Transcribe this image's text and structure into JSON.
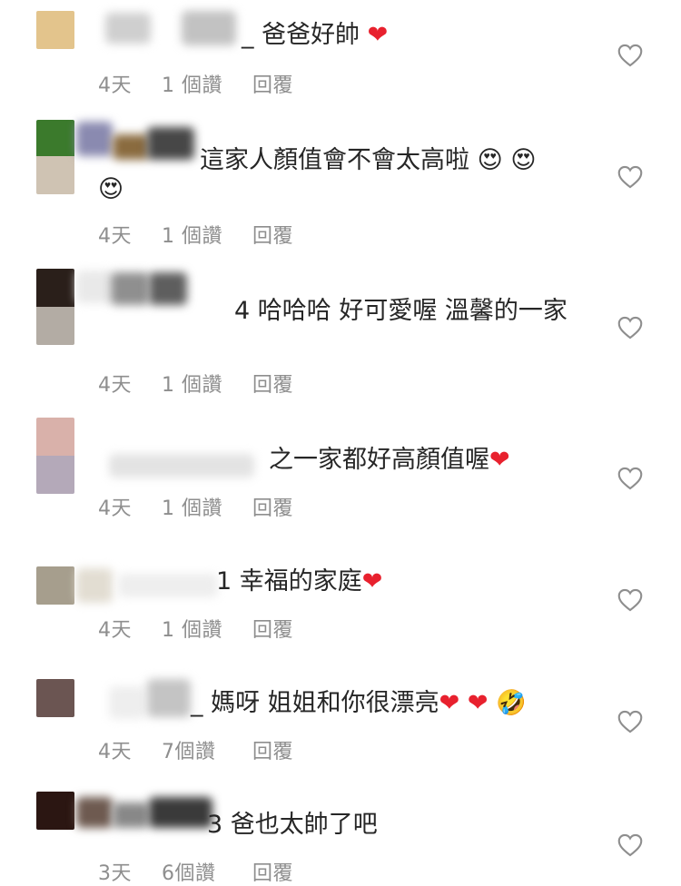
{
  "comments": [
    {
      "text": "_ 爸爸好帥",
      "emoji": [
        "heart"
      ],
      "time": "4天",
      "likes": "1 個讚",
      "reply": "回覆",
      "avatar_colors": [
        "#e3c48c"
      ]
    },
    {
      "text": "這家人顏值會不會太高啦",
      "emoji": [
        "heart-eyes",
        "heart-eyes",
        "heart-eyes"
      ],
      "time": "4天",
      "likes": "1 個讚",
      "reply": "回覆",
      "avatar_colors": [
        "#3b7a2c",
        "#cfc3b3"
      ]
    },
    {
      "text": "4 哈哈哈 好可愛喔 溫馨的一家",
      "emoji": [],
      "time": "4天",
      "likes": "1 個讚",
      "reply": "回覆",
      "avatar_colors": [
        "#2a1f1a",
        "#b3aca4"
      ]
    },
    {
      "text": "之一家都好高顏值喔",
      "emoji": [
        "heart"
      ],
      "time": "4天",
      "likes": "1 個讚",
      "reply": "回覆",
      "avatar_colors": [
        "#d9b1aa",
        "#b4a9b9"
      ]
    },
    {
      "text": "1 幸福的家庭",
      "emoji": [
        "heart"
      ],
      "time": "4天",
      "likes": "1 個讚",
      "reply": "回覆",
      "avatar_colors": [
        "#a69e8d"
      ]
    },
    {
      "text": "_ 媽呀 姐姐和你很漂亮",
      "emoji": [
        "heart",
        "heart",
        "rofl"
      ],
      "time": "4天",
      "likes": "7個讚",
      "reply": "回覆",
      "avatar_colors": [
        "#6b5552"
      ]
    },
    {
      "text": "3 爸也太帥了吧",
      "emoji": [],
      "time": "3天",
      "likes": "6個讚",
      "reply": "回覆",
      "avatar_colors": [
        "#2b1612"
      ]
    }
  ],
  "colors": {
    "text": "#262626",
    "meta": "#8e8e8e",
    "heart": "#e8212e",
    "like_outline": "#8e8e8e"
  }
}
